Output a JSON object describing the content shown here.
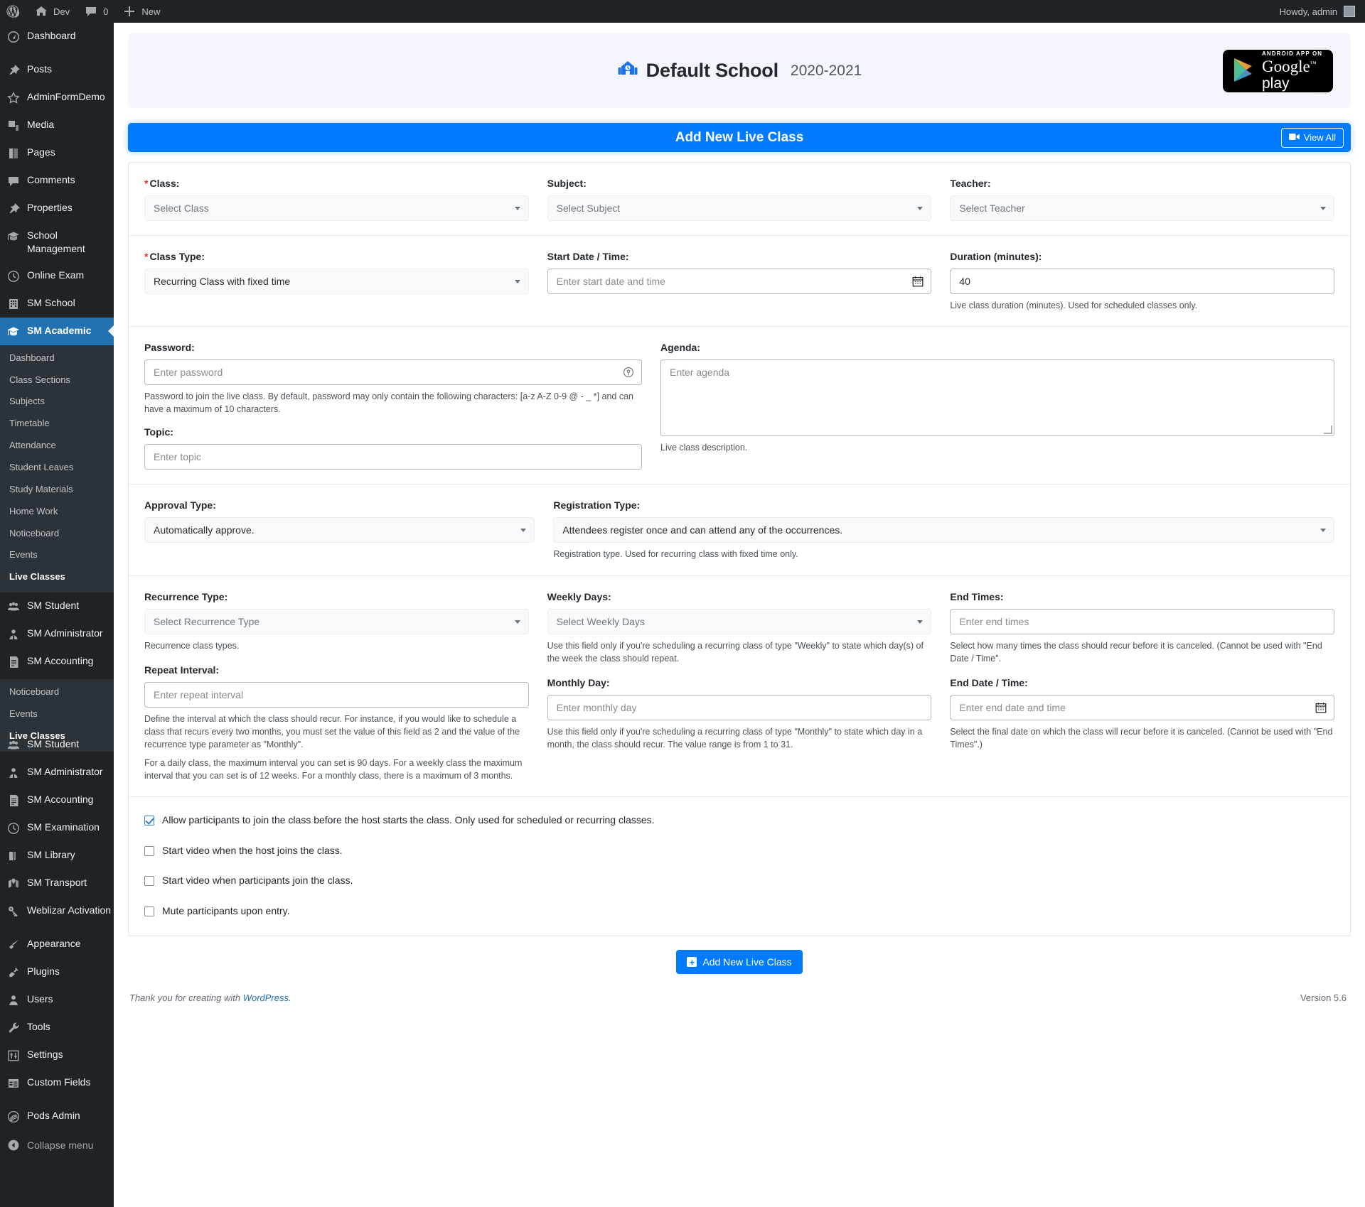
{
  "adminbar": {
    "wp_logo_icon": "wordpress-logo-icon",
    "site_name": "Dev",
    "site_icon": "home-icon",
    "comments_icon": "comment-bubble-icon",
    "comments_count": "0",
    "new_icon": "plus-icon",
    "new_label": "New",
    "howdy": "Howdy, admin",
    "avatar": "avatar"
  },
  "sidebar": {
    "top_items": [
      {
        "label": "Dashboard",
        "icon": "dashboard-icon"
      },
      {
        "label": "Posts",
        "icon": "pin-icon"
      },
      {
        "label": "AdminFormDemo",
        "icon": "star-icon"
      },
      {
        "label": "Media",
        "icon": "media-icon"
      },
      {
        "label": "Pages",
        "icon": "pages-icon"
      },
      {
        "label": "Comments",
        "icon": "comment-bubble-icon"
      },
      {
        "label": "Properties",
        "icon": "pin-icon"
      },
      {
        "label": "School Management",
        "icon": "graduation-cap-icon"
      },
      {
        "label": "Online Exam",
        "icon": "clock-icon"
      },
      {
        "label": "SM School",
        "icon": "building-icon"
      }
    ],
    "current_item": {
      "label": "SM Academic",
      "icon": "graduation-cap-icon"
    },
    "submenu": [
      {
        "label": "Dashboard",
        "current": false
      },
      {
        "label": "Class Sections",
        "current": false
      },
      {
        "label": "Subjects",
        "current": false
      },
      {
        "label": "Timetable",
        "current": false
      },
      {
        "label": "Attendance",
        "current": false
      },
      {
        "label": "Student Leaves",
        "current": false
      },
      {
        "label": "Study Materials",
        "current": false
      },
      {
        "label": "Home Work",
        "current": false
      },
      {
        "label": "Noticeboard",
        "current": false
      },
      {
        "label": "Events",
        "current": false
      },
      {
        "label": "Live Classes",
        "current": true
      }
    ],
    "mid_items": [
      {
        "label": "SM Student",
        "icon": "users-group-icon"
      },
      {
        "label": "SM Administrator",
        "icon": "user-badge-icon"
      },
      {
        "label": "SM Accounting",
        "icon": "ledger-icon"
      },
      {
        "label": "SM Examination",
        "icon": "clock-icon"
      },
      {
        "label": "SM Library",
        "icon": "book-icon"
      }
    ],
    "overlay_submenu": [
      {
        "label": "Noticeboard",
        "current": false
      },
      {
        "label": "Events",
        "current": false
      },
      {
        "label": "Live Classes",
        "current": true
      }
    ],
    "mid_items2": [
      {
        "label": "SM Student",
        "icon": "users-group-icon"
      },
      {
        "label": "SM Administrator",
        "icon": "user-badge-icon"
      },
      {
        "label": "SM Accounting",
        "icon": "ledger-icon"
      },
      {
        "label": "SM Examination",
        "icon": "clock-icon"
      },
      {
        "label": "SM Library",
        "icon": "book-icon"
      },
      {
        "label": "SM Transport",
        "icon": "map-pin-icon"
      },
      {
        "label": "Weblizar Activation",
        "icon": "key-icon"
      }
    ],
    "wp_items": [
      {
        "label": "Appearance",
        "icon": "paintbrush-icon"
      },
      {
        "label": "Plugins",
        "icon": "plug-icon"
      },
      {
        "label": "Users",
        "icon": "user-icon"
      },
      {
        "label": "Tools",
        "icon": "wrench-icon"
      },
      {
        "label": "Settings",
        "icon": "sliders-icon"
      },
      {
        "label": "Custom Fields",
        "icon": "table-icon"
      }
    ],
    "pods": {
      "label": "Pods Admin",
      "icon": "pods-icon"
    },
    "collapse": {
      "label": "Collapse menu",
      "icon": "collapse-arrow-icon"
    }
  },
  "school_header": {
    "logo_icon": "school-building-icon",
    "name": "Default School",
    "year": "2020-2021",
    "gplay": {
      "icon": "google-play-triangle-icon",
      "small_text": "ANDROID APP ON",
      "brand": "Google",
      "brand_tm": "™",
      "play": "play"
    }
  },
  "page_bar": {
    "title": "Add New Live Class",
    "view_all_label": "View All",
    "view_all_icon": "video-camera-icon",
    "accent_color": "#007bff"
  },
  "form": {
    "row1": {
      "class": {
        "label": "Class:",
        "required": true,
        "placeholder": "Select Class",
        "value": ""
      },
      "subject": {
        "label": "Subject:",
        "required": false,
        "placeholder": "Select Subject",
        "value": ""
      },
      "teacher": {
        "label": "Teacher:",
        "required": false,
        "placeholder": "Select Teacher",
        "value": ""
      }
    },
    "row2": {
      "class_type": {
        "label": "Class Type:",
        "required": true,
        "value": "Recurring Class with fixed time"
      },
      "start_datetime": {
        "label": "Start Date / Time:",
        "placeholder": "Enter start date and time",
        "value": "",
        "icon": "calendar-icon"
      },
      "duration": {
        "label": "Duration (minutes):",
        "value": "40",
        "help": "Live class duration (minutes). Used for scheduled classes only."
      }
    },
    "row3": {
      "password": {
        "label": "Password:",
        "placeholder": "Enter password",
        "value": "",
        "icon": "password-reveal-icon",
        "help": "Password to join the live class. By default, password may only contain the following characters: [a-z A-Z 0-9 @ - _ *] and can have a maximum of 10 characters."
      },
      "topic": {
        "label": "Topic:",
        "placeholder": "Enter topic",
        "value": ""
      },
      "agenda": {
        "label": "Agenda:",
        "placeholder": "Enter agenda",
        "value": "",
        "help": "Live class description."
      }
    },
    "row4": {
      "approval_type": {
        "label": "Approval Type:",
        "value": "Automatically approve."
      },
      "registration_type": {
        "label": "Registration Type:",
        "value": "Attendees register once and can attend any of the occurrences.",
        "help": "Registration type. Used for recurring class with fixed time only."
      }
    },
    "row5": {
      "recurrence_type": {
        "label": "Recurrence Type:",
        "placeholder": "Select Recurrence Type",
        "value": "",
        "help": "Recurrence class types."
      },
      "weekly_days": {
        "label": "Weekly Days:",
        "placeholder": "Select Weekly Days",
        "value": "",
        "help": "Use this field only if you're scheduling a recurring class of type \"Weekly\" to state which day(s) of the week the class should repeat."
      },
      "end_times": {
        "label": "End Times:",
        "placeholder": "Enter end times",
        "value": "",
        "help": "Select how many times the class should recur before it is canceled. (Cannot be used with \"End Date / Time\"."
      },
      "repeat_interval": {
        "label": "Repeat Interval:",
        "placeholder": "Enter repeat interval",
        "value": "",
        "help1": "Define the interval at which the class should recur. For instance, if you would like to schedule a class that recurs every two months, you must set the value of this field as 2 and the value of the recurrence type parameter as \"Monthly\".",
        "help2": "For a daily class, the maximum interval you can set is 90 days. For a weekly class the maximum interval that you can set is of 12 weeks. For a monthly class, there is a maximum of 3 months."
      },
      "monthly_day": {
        "label": "Monthly Day:",
        "placeholder": "Enter monthly day",
        "value": "",
        "help": "Use this field only if you're scheduling a recurring class of type \"Monthly\" to state which day in a month, the class should recur. The value range is from 1 to 31."
      },
      "end_datetime": {
        "label": "End Date / Time:",
        "placeholder": "Enter end date and time",
        "value": "",
        "icon": "calendar-icon",
        "help": "Select the final date on which the class will recur before it is canceled. (Cannot be used with \"End Times\".)"
      }
    },
    "checkboxes": [
      {
        "label": "Allow participants to join the class before the host starts the class. Only used for scheduled or recurring classes.",
        "checked": true
      },
      {
        "label": "Start video when the host joins the class.",
        "checked": false
      },
      {
        "label": "Start video when participants join the class.",
        "checked": false
      },
      {
        "label": "Mute participants upon entry.",
        "checked": false
      }
    ],
    "submit": {
      "label": "Add New Live Class",
      "icon": "plus-icon"
    }
  },
  "footer": {
    "thanks_prefix": "Thank you for creating with ",
    "wordpress_link": "WordPress",
    "thanks_suffix": ".",
    "version": "Version 5.6"
  }
}
